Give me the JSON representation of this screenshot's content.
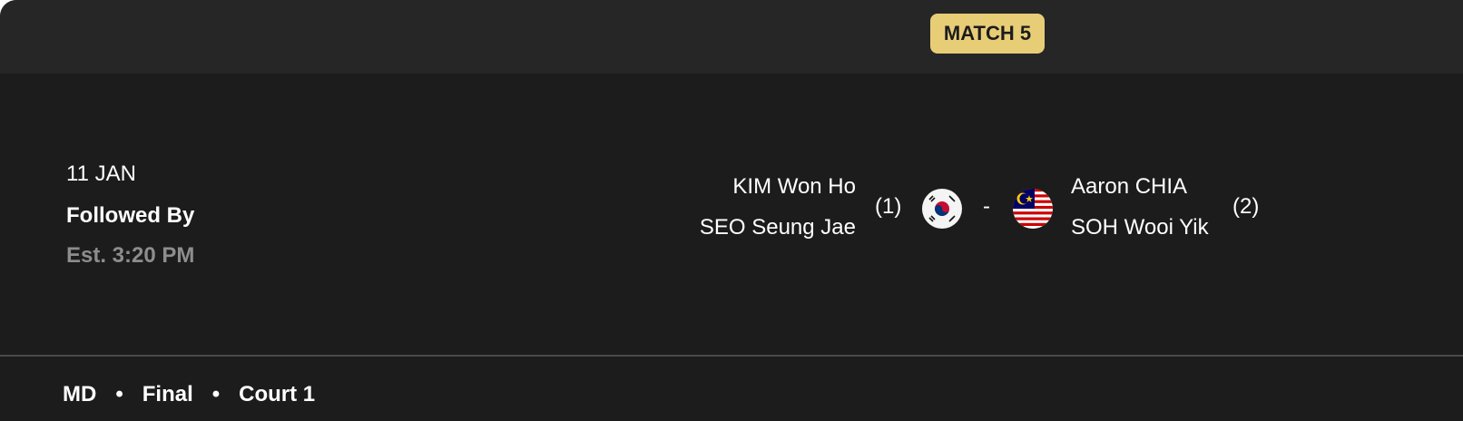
{
  "match": {
    "badge": "MATCH 5",
    "badge_color": "#e8cd77"
  },
  "schedule": {
    "date": "11 JAN",
    "followed_by": "Followed By",
    "estimate": "Est. 3:20 PM"
  },
  "team_left": {
    "players": [
      "KIM Won Ho",
      "SEO Seung Jae"
    ],
    "seed": "(1)",
    "flag_icon": "south-korea-flag-icon"
  },
  "separator": "-",
  "team_right": {
    "players": [
      "Aaron CHIA",
      "SOH Wooi Yik"
    ],
    "seed": "(2)",
    "flag_icon": "malaysia-flag-icon"
  },
  "footer": {
    "category": "MD",
    "round": "Final",
    "court": "Court 1",
    "dot": "•"
  },
  "colors": {
    "background": "#1c1c1c",
    "header": "#262626",
    "muted_text": "#8d8d8d"
  }
}
